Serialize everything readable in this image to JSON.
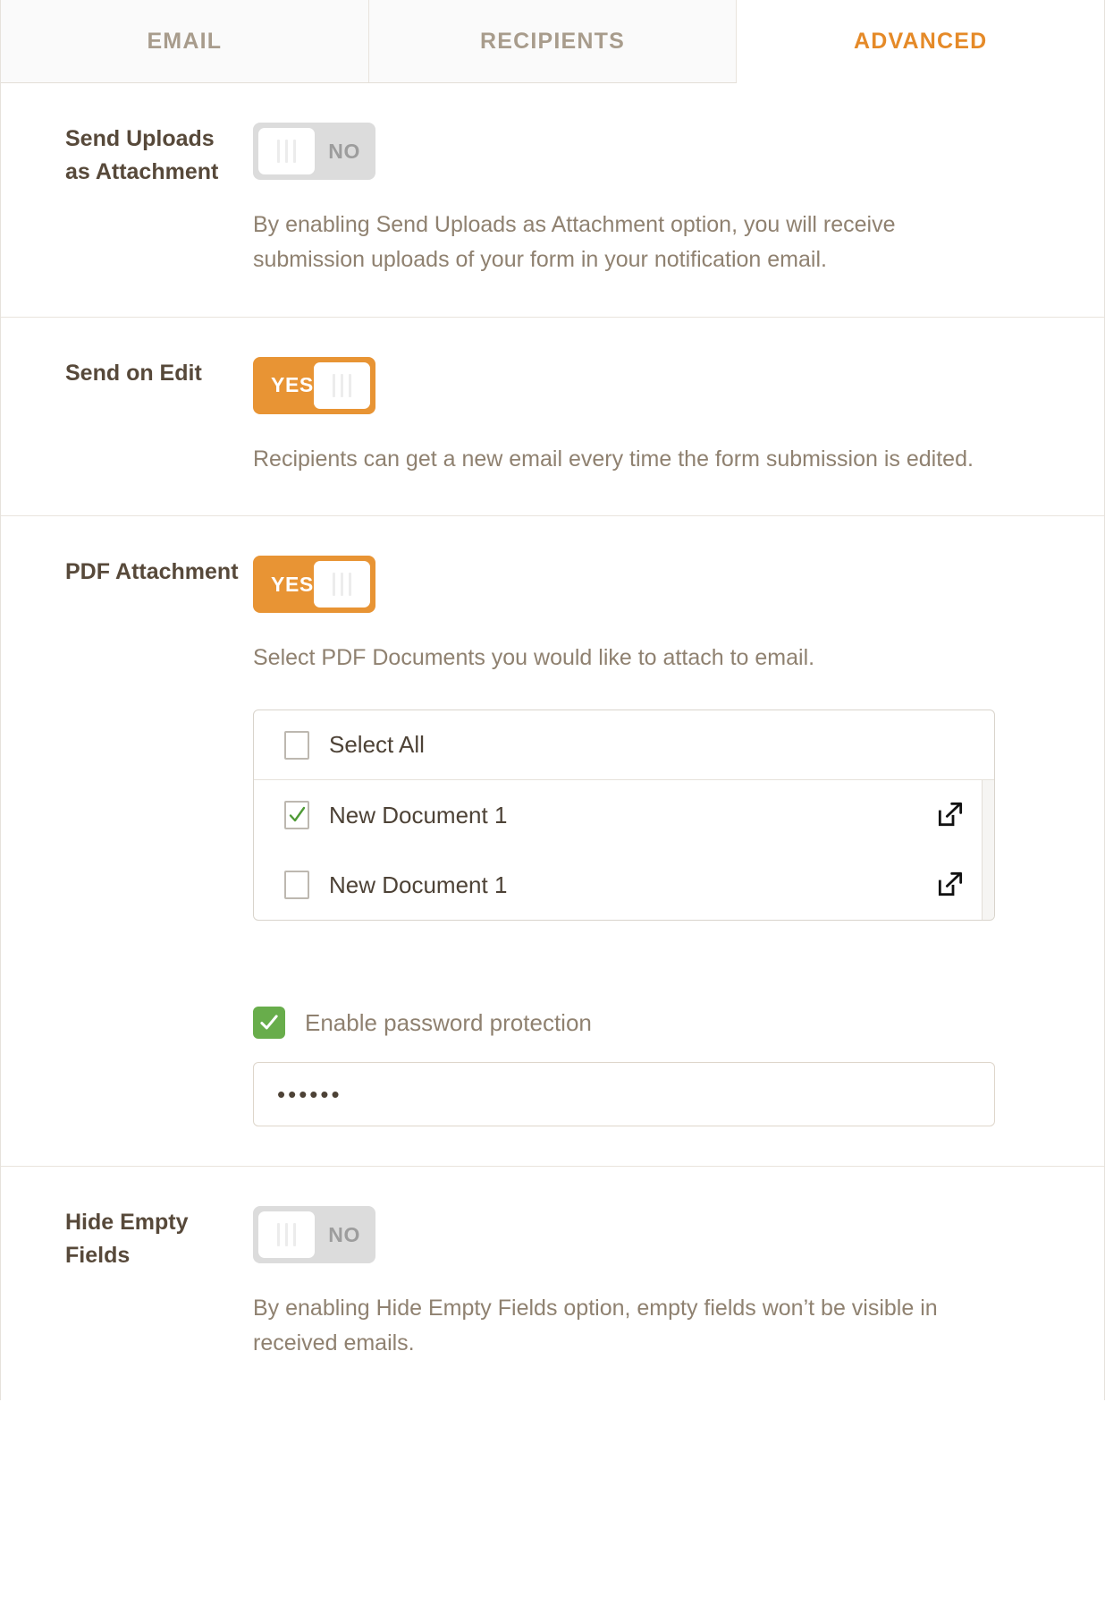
{
  "colors": {
    "accent": "#e58a28",
    "toggle_on": "#e89434",
    "toggle_off": "#dcdcdc",
    "checkbox_green": "#68ad4b",
    "label_text": "#57493a",
    "desc_text": "#8f8170"
  },
  "tabs": [
    {
      "label": "EMAIL",
      "active": false
    },
    {
      "label": "RECIPIENTS",
      "active": false
    },
    {
      "label": "ADVANCED",
      "active": true
    }
  ],
  "settings": [
    {
      "label": "Send Uploads as Attachment",
      "toggle_state": "NO",
      "description": "By enabling Send Uploads as Attachment option, you will receive submission uploads of your form in your notification email."
    },
    {
      "label": "Send on Edit",
      "toggle_state": "YES",
      "description": "Recipients can get a new email every time the form submission is edited."
    },
    {
      "label": "PDF Attachment",
      "toggle_state": "YES",
      "description": "Select PDF Documents you would like to attach to email."
    },
    {
      "label": "Hide Empty Fields",
      "toggle_state": "NO",
      "description": "By enabling Hide Empty Fields option, empty fields won’t be visible in received emails."
    }
  ],
  "pdf_list": {
    "select_all_label": "Select All",
    "select_all_checked": false,
    "items": [
      {
        "label": "New Document 1",
        "checked": true,
        "icon": "external-link-icon"
      },
      {
        "label": "New Document 1",
        "checked": false,
        "icon": "external-link-icon"
      }
    ]
  },
  "password": {
    "checkbox_label": "Enable password protection",
    "checkbox_checked": true,
    "value": "••••••",
    "placeholder": ""
  },
  "icons": {
    "check": "check-icon",
    "external_link": "external-link-icon",
    "toggle_grip": "grip-lines-icon"
  }
}
